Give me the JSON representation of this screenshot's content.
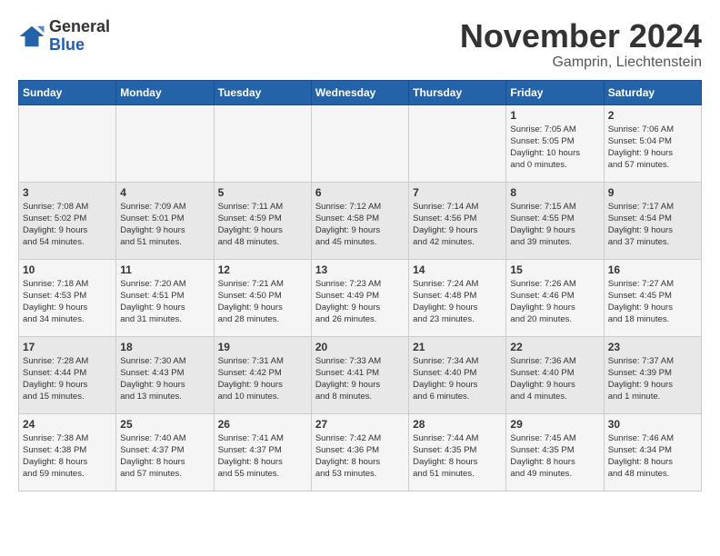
{
  "logo": {
    "general": "General",
    "blue": "Blue"
  },
  "title": "November 2024",
  "location": "Gamprin, Liechtenstein",
  "days_of_week": [
    "Sunday",
    "Monday",
    "Tuesday",
    "Wednesday",
    "Thursday",
    "Friday",
    "Saturday"
  ],
  "weeks": [
    [
      {
        "day": "",
        "info": ""
      },
      {
        "day": "",
        "info": ""
      },
      {
        "day": "",
        "info": ""
      },
      {
        "day": "",
        "info": ""
      },
      {
        "day": "",
        "info": ""
      },
      {
        "day": "1",
        "info": "Sunrise: 7:05 AM\nSunset: 5:05 PM\nDaylight: 10 hours\nand 0 minutes."
      },
      {
        "day": "2",
        "info": "Sunrise: 7:06 AM\nSunset: 5:04 PM\nDaylight: 9 hours\nand 57 minutes."
      }
    ],
    [
      {
        "day": "3",
        "info": "Sunrise: 7:08 AM\nSunset: 5:02 PM\nDaylight: 9 hours\nand 54 minutes."
      },
      {
        "day": "4",
        "info": "Sunrise: 7:09 AM\nSunset: 5:01 PM\nDaylight: 9 hours\nand 51 minutes."
      },
      {
        "day": "5",
        "info": "Sunrise: 7:11 AM\nSunset: 4:59 PM\nDaylight: 9 hours\nand 48 minutes."
      },
      {
        "day": "6",
        "info": "Sunrise: 7:12 AM\nSunset: 4:58 PM\nDaylight: 9 hours\nand 45 minutes."
      },
      {
        "day": "7",
        "info": "Sunrise: 7:14 AM\nSunset: 4:56 PM\nDaylight: 9 hours\nand 42 minutes."
      },
      {
        "day": "8",
        "info": "Sunrise: 7:15 AM\nSunset: 4:55 PM\nDaylight: 9 hours\nand 39 minutes."
      },
      {
        "day": "9",
        "info": "Sunrise: 7:17 AM\nSunset: 4:54 PM\nDaylight: 9 hours\nand 37 minutes."
      }
    ],
    [
      {
        "day": "10",
        "info": "Sunrise: 7:18 AM\nSunset: 4:53 PM\nDaylight: 9 hours\nand 34 minutes."
      },
      {
        "day": "11",
        "info": "Sunrise: 7:20 AM\nSunset: 4:51 PM\nDaylight: 9 hours\nand 31 minutes."
      },
      {
        "day": "12",
        "info": "Sunrise: 7:21 AM\nSunset: 4:50 PM\nDaylight: 9 hours\nand 28 minutes."
      },
      {
        "day": "13",
        "info": "Sunrise: 7:23 AM\nSunset: 4:49 PM\nDaylight: 9 hours\nand 26 minutes."
      },
      {
        "day": "14",
        "info": "Sunrise: 7:24 AM\nSunset: 4:48 PM\nDaylight: 9 hours\nand 23 minutes."
      },
      {
        "day": "15",
        "info": "Sunrise: 7:26 AM\nSunset: 4:46 PM\nDaylight: 9 hours\nand 20 minutes."
      },
      {
        "day": "16",
        "info": "Sunrise: 7:27 AM\nSunset: 4:45 PM\nDaylight: 9 hours\nand 18 minutes."
      }
    ],
    [
      {
        "day": "17",
        "info": "Sunrise: 7:28 AM\nSunset: 4:44 PM\nDaylight: 9 hours\nand 15 minutes."
      },
      {
        "day": "18",
        "info": "Sunrise: 7:30 AM\nSunset: 4:43 PM\nDaylight: 9 hours\nand 13 minutes."
      },
      {
        "day": "19",
        "info": "Sunrise: 7:31 AM\nSunset: 4:42 PM\nDaylight: 9 hours\nand 10 minutes."
      },
      {
        "day": "20",
        "info": "Sunrise: 7:33 AM\nSunset: 4:41 PM\nDaylight: 9 hours\nand 8 minutes."
      },
      {
        "day": "21",
        "info": "Sunrise: 7:34 AM\nSunset: 4:40 PM\nDaylight: 9 hours\nand 6 minutes."
      },
      {
        "day": "22",
        "info": "Sunrise: 7:36 AM\nSunset: 4:40 PM\nDaylight: 9 hours\nand 4 minutes."
      },
      {
        "day": "23",
        "info": "Sunrise: 7:37 AM\nSunset: 4:39 PM\nDaylight: 9 hours\nand 1 minute."
      }
    ],
    [
      {
        "day": "24",
        "info": "Sunrise: 7:38 AM\nSunset: 4:38 PM\nDaylight: 8 hours\nand 59 minutes."
      },
      {
        "day": "25",
        "info": "Sunrise: 7:40 AM\nSunset: 4:37 PM\nDaylight: 8 hours\nand 57 minutes."
      },
      {
        "day": "26",
        "info": "Sunrise: 7:41 AM\nSunset: 4:37 PM\nDaylight: 8 hours\nand 55 minutes."
      },
      {
        "day": "27",
        "info": "Sunrise: 7:42 AM\nSunset: 4:36 PM\nDaylight: 8 hours\nand 53 minutes."
      },
      {
        "day": "28",
        "info": "Sunrise: 7:44 AM\nSunset: 4:35 PM\nDaylight: 8 hours\nand 51 minutes."
      },
      {
        "day": "29",
        "info": "Sunrise: 7:45 AM\nSunset: 4:35 PM\nDaylight: 8 hours\nand 49 minutes."
      },
      {
        "day": "30",
        "info": "Sunrise: 7:46 AM\nSunset: 4:34 PM\nDaylight: 8 hours\nand 48 minutes."
      }
    ]
  ]
}
